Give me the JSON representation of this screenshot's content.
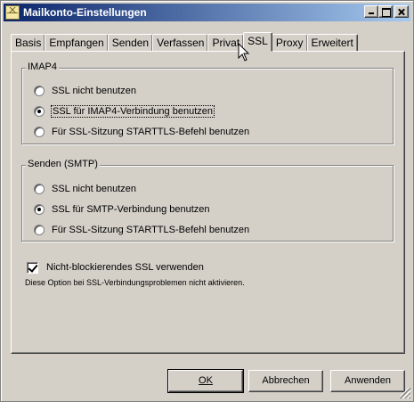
{
  "window": {
    "title": "Mailkonto-Einstellungen"
  },
  "tabs": [
    {
      "label": "Basis"
    },
    {
      "label": "Empfangen"
    },
    {
      "label": "Senden"
    },
    {
      "label": "Verfassen"
    },
    {
      "label": "Privat"
    },
    {
      "label": "SSL",
      "active": true
    },
    {
      "label": "Proxy"
    },
    {
      "label": "Erweitert"
    }
  ],
  "imap_group": {
    "title": "IMAP4",
    "options": [
      {
        "label": "SSL nicht benutzen",
        "checked": false
      },
      {
        "label": "SSL für IMAP4-Verbindung benutzen",
        "checked": true
      },
      {
        "label": "Für SSL-Sitzung STARTTLS-Befehl benutzen",
        "checked": false
      }
    ]
  },
  "smtp_group": {
    "title": "Senden (SMTP)",
    "options": [
      {
        "label": "SSL nicht benutzen",
        "checked": false
      },
      {
        "label": "SSL für SMTP-Verbindung benutzen",
        "checked": true
      },
      {
        "label": "Für SSL-Sitzung STARTTLS-Befehl benutzen",
        "checked": false
      }
    ]
  },
  "nonblocking": {
    "label": "Nicht-blockierendes SSL verwenden",
    "checked": true,
    "hint": "Diese Option bei SSL-Verbindungsproblemen nicht aktivieren."
  },
  "buttons": {
    "ok": "OK",
    "cancel": "Abbrechen",
    "apply": "Anwenden"
  },
  "colors": {
    "titlebar_start": "#0a246a",
    "titlebar_end": "#a6caf0",
    "dialog_bg": "#d4d0c8"
  }
}
